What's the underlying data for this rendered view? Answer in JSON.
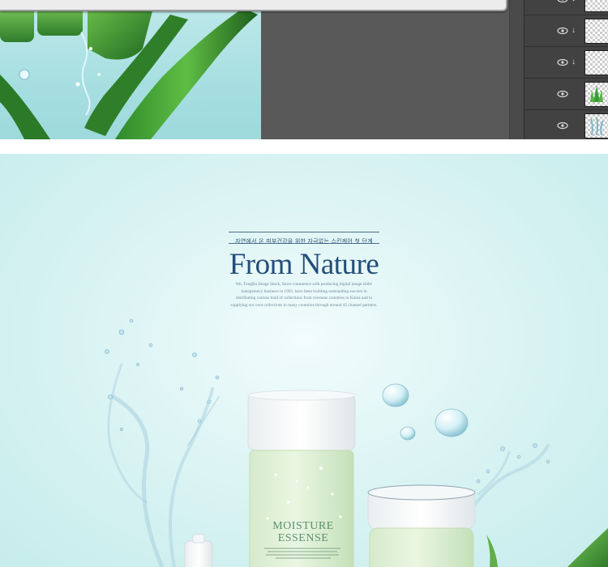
{
  "editor": {
    "layers": [
      {
        "name": "layer-1",
        "visible": true,
        "clipped": true
      },
      {
        "name": "layer-2",
        "visible": true,
        "clipped": true
      },
      {
        "name": "layer-3",
        "visible": true,
        "clipped": true
      },
      {
        "name": "layer-4",
        "visible": true,
        "clipped": false
      },
      {
        "name": "layer-5",
        "visible": true,
        "clipped": false
      }
    ]
  },
  "poster": {
    "subtitle": "자연에서 온 피부건강을 위한 자극없는 스킨케어 첫 단계",
    "headline": "From Nature",
    "body_lines": [
      "We, TongRo Image Stock, Since commence with producing digital image slide/",
      "transparency business in 1992, have been building outstanding success in",
      "distributing various kind of collections from overseas countries to Korea and in",
      "supplying our own collections to many countries through around 45 channel partners."
    ],
    "bottle_label_line1": "MOISTURE",
    "bottle_label_line2": "ESSENSE"
  },
  "colors": {
    "headline": "#244e79",
    "poster_bg": "#d8f2f2",
    "bottle_green": "#cfe8c6",
    "ps_panel": "#424242"
  }
}
